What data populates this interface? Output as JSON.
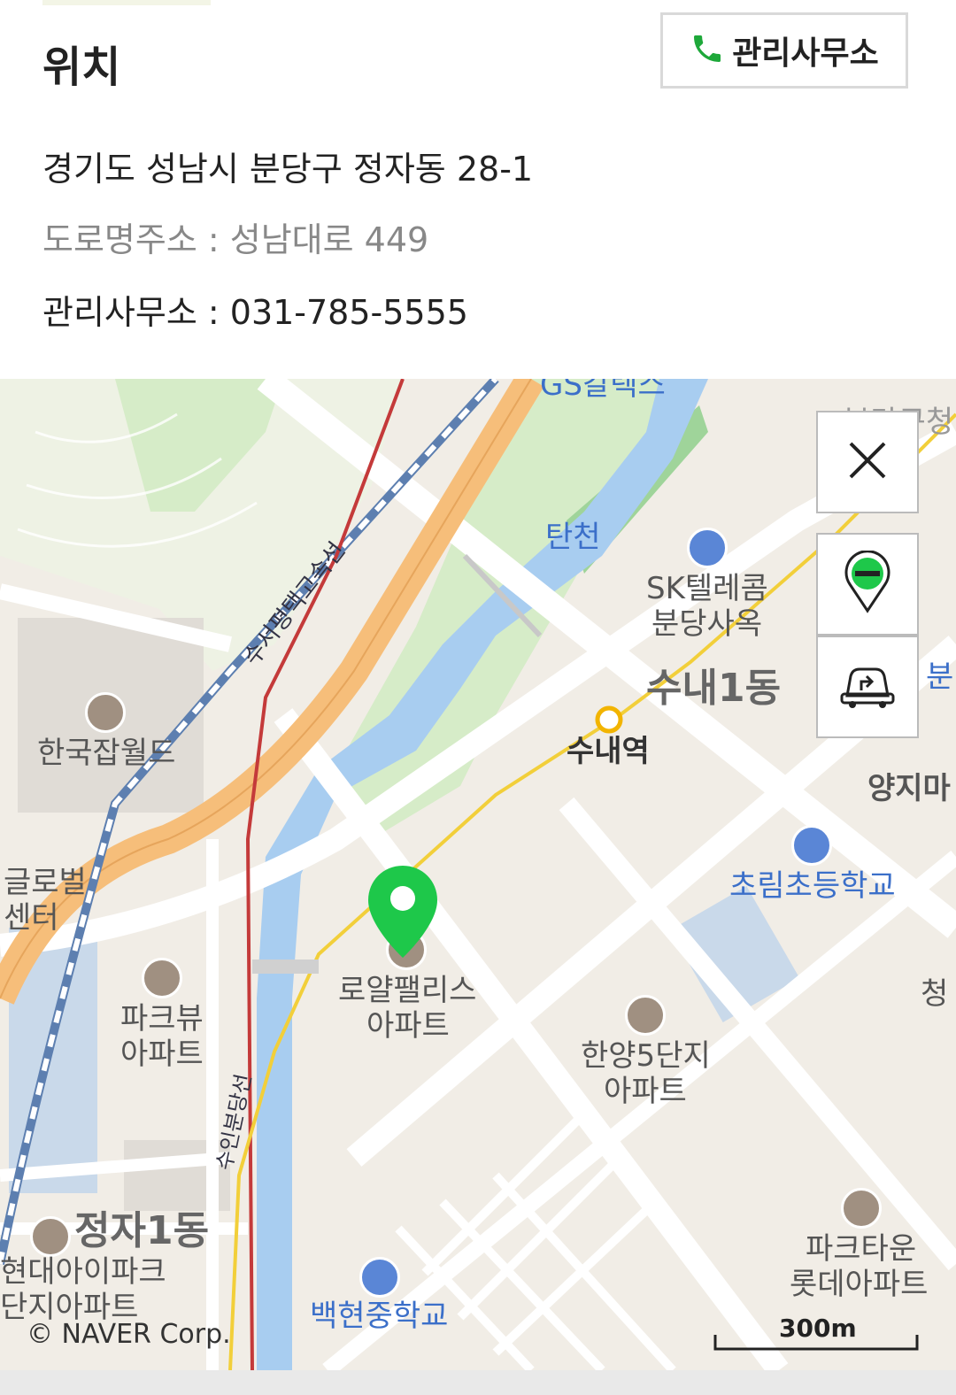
{
  "header": {
    "title": "위치",
    "office_button_label": "관리사무소"
  },
  "address": {
    "jibun": "경기도 성남시 분당구 정자동 28-1",
    "road": "도로명주소 : 성남대로 449",
    "office_phone": "관리사무소 : 031-785-5555"
  },
  "map": {
    "labels": {
      "gs": "GS칼텍스",
      "tancheon": "탄천",
      "sk1": "SK텔레콤",
      "sk2": "분당사옥",
      "sunae1dong": "수내1동",
      "sunae_station": "수내역",
      "yangji": "양지마",
      "bun": "분",
      "chorim": "초림초등학교",
      "korea_jobworld": "한국잡월드",
      "global1": "글로벌",
      "global2": "센터",
      "royal1": "로얄팰리스",
      "royal2": "아파트",
      "parkview1": "파크뷰",
      "parkview2": "아파트",
      "hanyang1": "한양5단지",
      "hanyang2": "아파트",
      "jeongja1dong": "정자1동",
      "hyundai1": "현대아이파크",
      "hyundai2": "단지아파트",
      "baekhyeon": "백현중학교",
      "parktown1": "파크타운",
      "parktown2": "롯데아파트",
      "cheong": "청",
      "bundang_gu": "분당구청",
      "suseo_line": "수서평택고속선",
      "suin_line": "수인분당선"
    },
    "copyright": "© NAVER Corp.",
    "scale": "300m"
  },
  "icons": {
    "phone": "phone-icon",
    "close": "close-icon",
    "transit": "transit-icon",
    "directions": "car-directions-icon",
    "marker": "location-marker-icon"
  },
  "colors": {
    "phone_green": "#1ea83a",
    "marker_green": "#1ec84a",
    "river_blue": "#a8cdf0",
    "highway_orange": "#f6be7a",
    "park_green": "#d6ecc8",
    "subway_yellow": "#f2cf3a",
    "rail_red": "#c43a3a"
  }
}
